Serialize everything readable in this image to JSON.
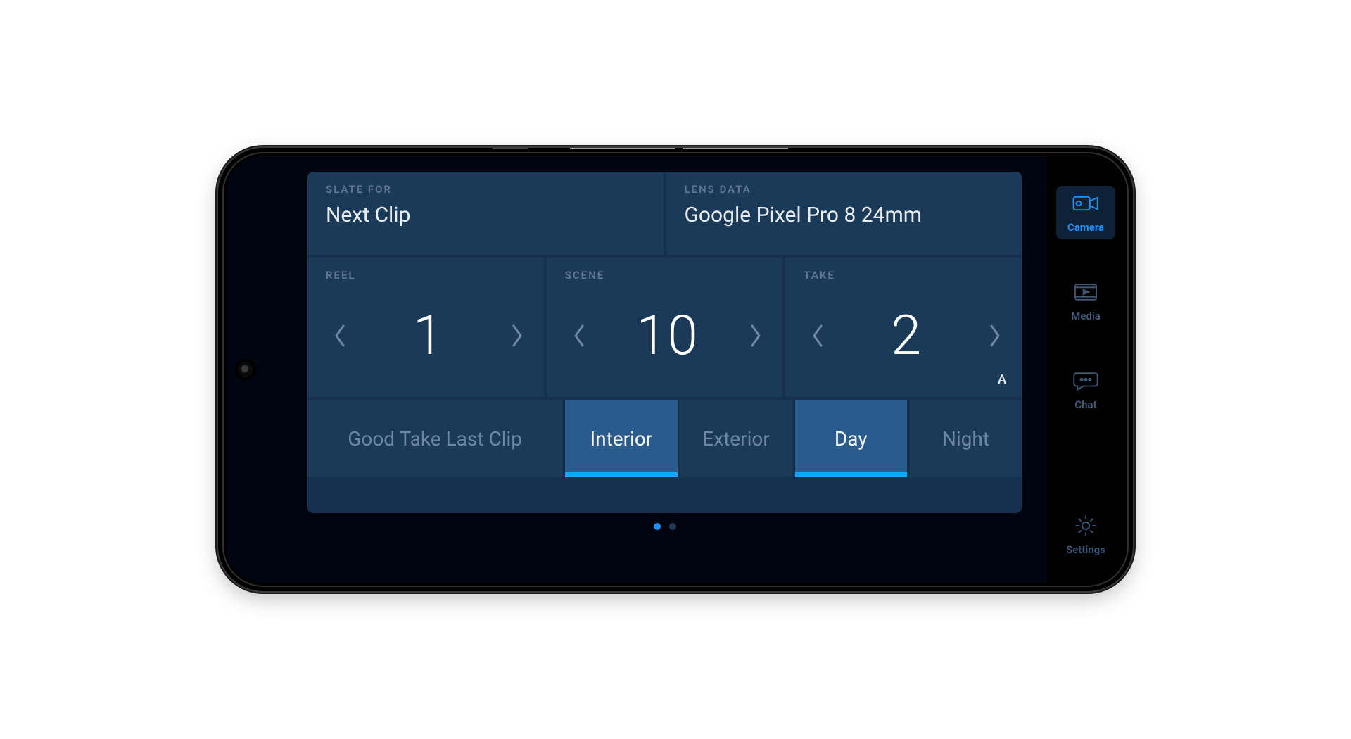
{
  "header": {
    "slate_for_label": "SLATE FOR",
    "slate_for_value": "Next Clip",
    "lens_data_label": "LENS DATA",
    "lens_data_value": "Google Pixel Pro 8 24mm"
  },
  "steppers": {
    "reel": {
      "label": "REEL",
      "value": "1"
    },
    "scene": {
      "label": "SCENE",
      "value": "10"
    },
    "take": {
      "label": "TAKE",
      "value": "2",
      "sub": "A"
    }
  },
  "options": {
    "good_take": "Good Take Last Clip",
    "interior": "Interior",
    "exterior": "Exterior",
    "day": "Day",
    "night": "Night"
  },
  "sidebar": {
    "camera": "Camera",
    "media": "Media",
    "chat": "Chat",
    "settings": "Settings"
  }
}
